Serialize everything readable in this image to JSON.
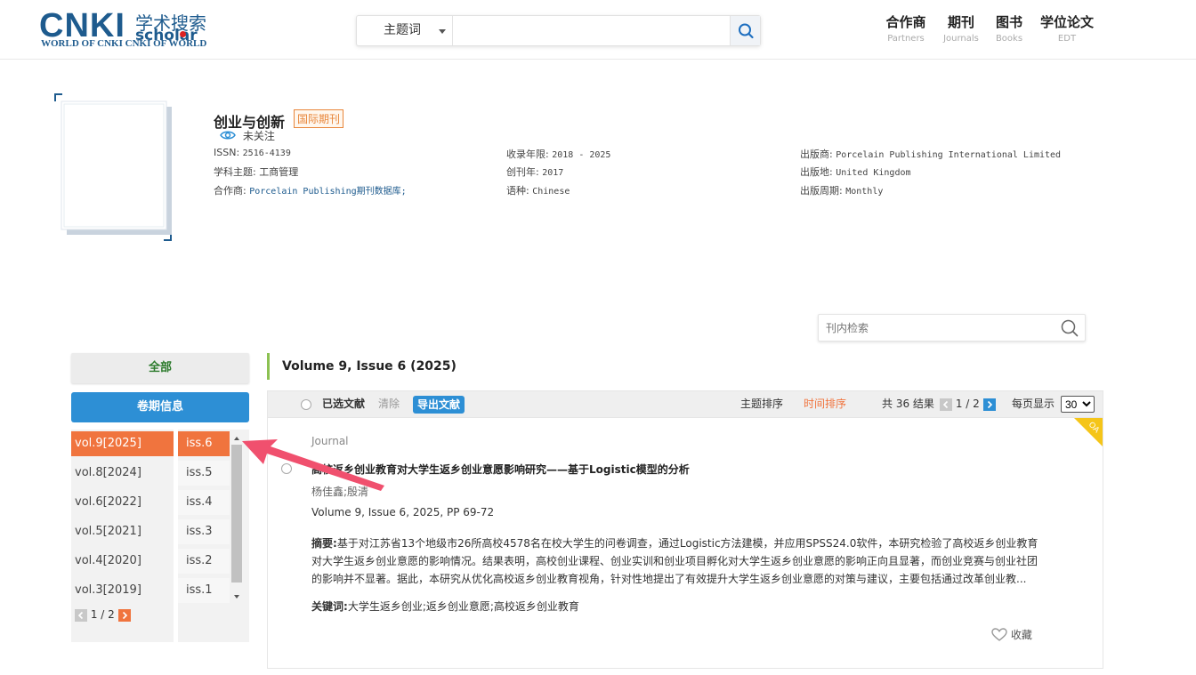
{
  "header": {
    "logo_main": "CNKI",
    "logo_cn": "学术搜索",
    "logo_en": "scholar",
    "logo_tagline": "WORLD OF CNKI CNKI OF WORLD",
    "search_field": "主题词",
    "search_value": "",
    "nav": [
      {
        "cn": "合作商",
        "en": "Partners"
      },
      {
        "cn": "期刊",
        "en": "Journals"
      },
      {
        "cn": "图书",
        "en": "Books"
      },
      {
        "cn": "学位论文",
        "en": "EDT"
      }
    ]
  },
  "journal": {
    "title": "创业与创新",
    "badge": "国际期刊",
    "follow": "未关注",
    "issn_label": "ISSN:",
    "issn": "2516-4139",
    "subject_label": "学科主题:",
    "subject": "工商管理",
    "partner_label": "合作商:",
    "partner": "Porcelain Publishing期刊数据库;",
    "years_label": "收录年限:",
    "years": "2018 - 2025",
    "founded_label": "创刊年:",
    "founded": "2017",
    "language_label": "语种:",
    "language": "Chinese",
    "publisher_label": "出版商:",
    "publisher": "Porcelain Publishing International Limited",
    "place_label": "出版地:",
    "place": "United Kingdom",
    "frequency_label": "出版周期:",
    "frequency": "Monthly"
  },
  "inner_search": {
    "placeholder": "刊内检索"
  },
  "sidebar": {
    "all_label": "全部",
    "issue_info_label": "卷期信息",
    "volumes": [
      "vol.9[2025]",
      "vol.8[2024]",
      "vol.6[2022]",
      "vol.5[2021]",
      "vol.4[2020]",
      "vol.3[2019]"
    ],
    "issues": [
      "iss.6",
      "iss.5",
      "iss.4",
      "iss.3",
      "iss.2",
      "iss.1"
    ],
    "pager": "1 / 2"
  },
  "main": {
    "volume_title": "Volume 9, Issue 6 (2025)",
    "toolbar": {
      "selected_label": "已选文献",
      "clear_label": "清除",
      "export_label": "导出文献",
      "sort_topic": "主题排序",
      "sort_time": "时间排序",
      "total": "共 36 结果",
      "page": "1 / 2",
      "per_page_label": "每页显示",
      "per_page": "30"
    },
    "article": {
      "type": "Journal",
      "title": "高校返乡创业教育对大学生返乡创业意愿影响研究——基于Logistic模型的分析",
      "authors": "杨佳鑫;殷清",
      "citation": "Volume 9, Issue 6, 2025, PP 69-72",
      "abstract_label": "摘要:",
      "abstract": "基于对江苏省13个地级市26所高校4578名在校大学生的问卷调查，通过Logistic方法建模，并应用SPSS24.0软件，本研究检验了高校返乡创业教育对大学生返乡创业意愿的影响情况。结果表明，高校创业课程、创业实训和创业项目孵化对大学生返乡创业意愿的影响正向且显著，而创业竞赛与创业社团的影响并不显著。据此，本研究从优化高校返乡创业教育视角，针对性地提出了有效提升大学生返乡创业意愿的对策与建议，主要包括通过改革创业教...",
      "keywords_label": "关键词:",
      "keywords": "大学生返乡创业;返乡创业意愿;高校返乡创业教育",
      "favorite_label": "收藏",
      "oa_label": "OA"
    }
  },
  "colors": {
    "brand": "#1e5b8e",
    "accent_orange": "#f0743e",
    "accent_blue": "#2d8fd5",
    "green": "#8cc152",
    "annotation_arrow": "#f0506e"
  }
}
